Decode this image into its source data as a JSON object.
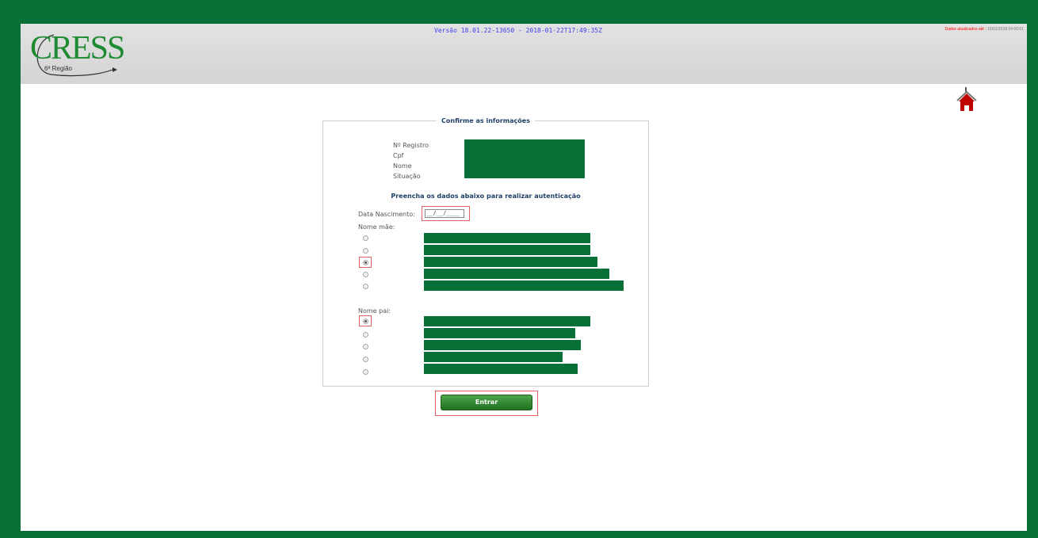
{
  "header": {
    "logo_text": "CRESS",
    "logo_subtitle": "6ª Região",
    "version": "Versão 18.01.22-13650 - 2018-01-22T17:49:35Z",
    "updated_label": "Dados atualizados até : ",
    "updated_timestamp": "15/01/2018 04:00:01",
    "home_icon": "home-icon"
  },
  "form": {
    "legend": "Confirme as informações",
    "info_labels": [
      "Nº Registro",
      "Cpf",
      "Nome",
      "Situação"
    ],
    "subtitle": "Preencha os dados abaixo para realizar autenticação",
    "dob_label": "Data Nascimento:",
    "dob_value": "__/__/____",
    "mother_label": "Nome mãe:",
    "father_label": "Nome pai:",
    "mother_selected_index": 2,
    "father_selected_index": 0,
    "submit_label": "Entrar"
  },
  "colors": {
    "brand_green": "#077036",
    "highlight_red": "#e06060",
    "version_blue": "#3e3ef0"
  }
}
